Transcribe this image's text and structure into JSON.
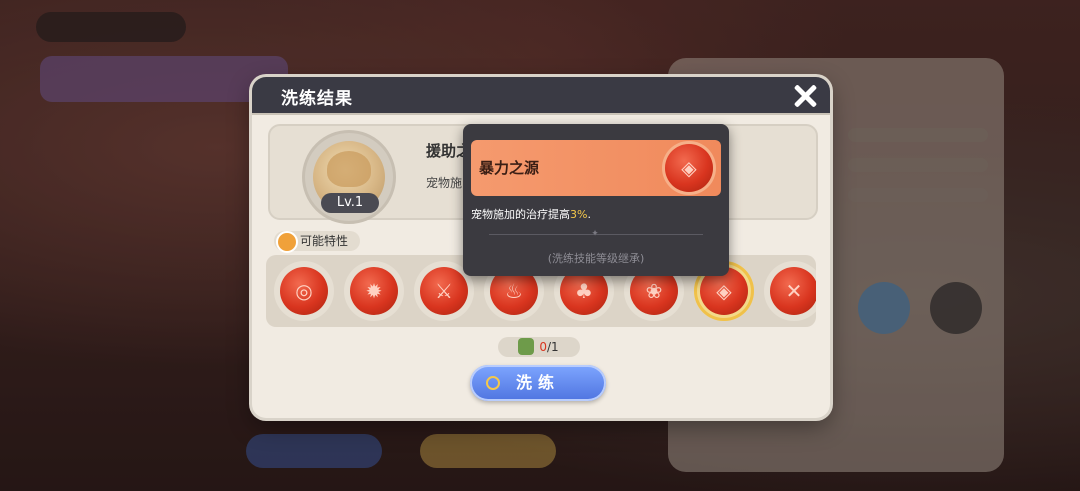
{
  "dialog": {
    "title": "洗练结果",
    "close_icon": "close-icon"
  },
  "skill": {
    "name": "援助之",
    "level": "Lv.1",
    "description": "宠物施"
  },
  "traits": {
    "label": "可能特性",
    "icons": [
      "ring-target-icon",
      "sun-star-icon",
      "crossed-swords-icon",
      "flame-claw-icon",
      "tree-icon",
      "gear-flower-icon",
      "shield-rune-icon",
      "cross-mark-icon"
    ],
    "selected_index": 6
  },
  "counter": {
    "current": "0",
    "total": "/1"
  },
  "refine_button": {
    "label": "洗练"
  },
  "tooltip": {
    "name": "暴力之源",
    "description_prefix": "宠物施加的治疗提高",
    "highlight": "3%",
    "description_suffix": ".",
    "note": "(洗练技能等级继承)"
  }
}
